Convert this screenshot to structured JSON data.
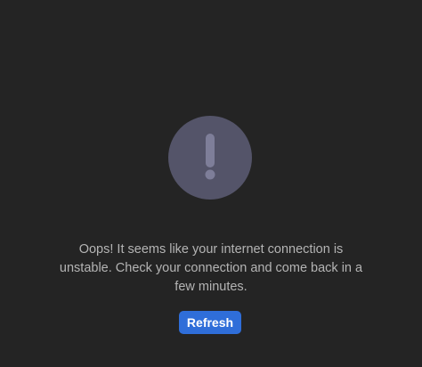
{
  "error": {
    "icon": "exclamation-icon",
    "message": "Oops! It seems like your internet connection is unstable. Check your connection and come back in a few minutes.",
    "refresh_label": "Refresh"
  },
  "colors": {
    "background": "#242424",
    "icon_circle": "#545469",
    "icon_glyph": "#7e7e99",
    "message_text": "#b4b4b4",
    "button_bg": "#2f6ed9",
    "button_text": "#ffffff"
  }
}
